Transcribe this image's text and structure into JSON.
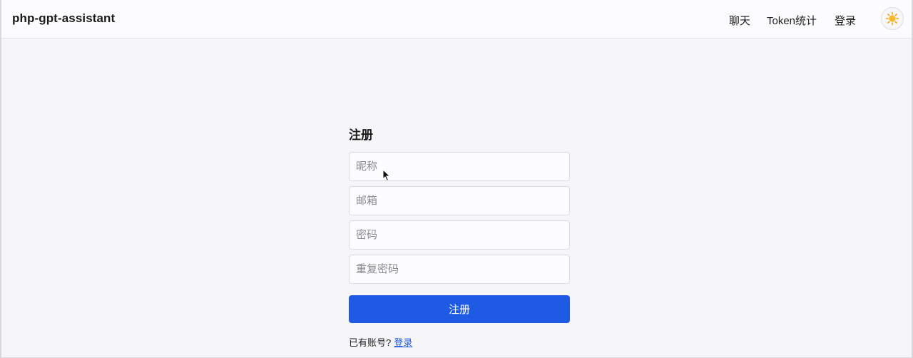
{
  "navbar": {
    "brand": "php-gpt-assistant",
    "links": [
      {
        "label": "聊天"
      },
      {
        "label": "Token统计"
      },
      {
        "label": "登录"
      }
    ],
    "theme_icon": "sun-icon"
  },
  "register_form": {
    "title": "注册",
    "fields": {
      "nickname_placeholder": "昵称",
      "email_placeholder": "邮箱",
      "password_placeholder": "密码",
      "confirm_password_placeholder": "重复密码"
    },
    "submit_label": "注册",
    "has_account_text": "已有账号?",
    "login_link": "登录"
  },
  "colors": {
    "accent": "#1e5ae3",
    "background": "#f6f5f8",
    "navbar_bg": "#fcfbfe"
  }
}
